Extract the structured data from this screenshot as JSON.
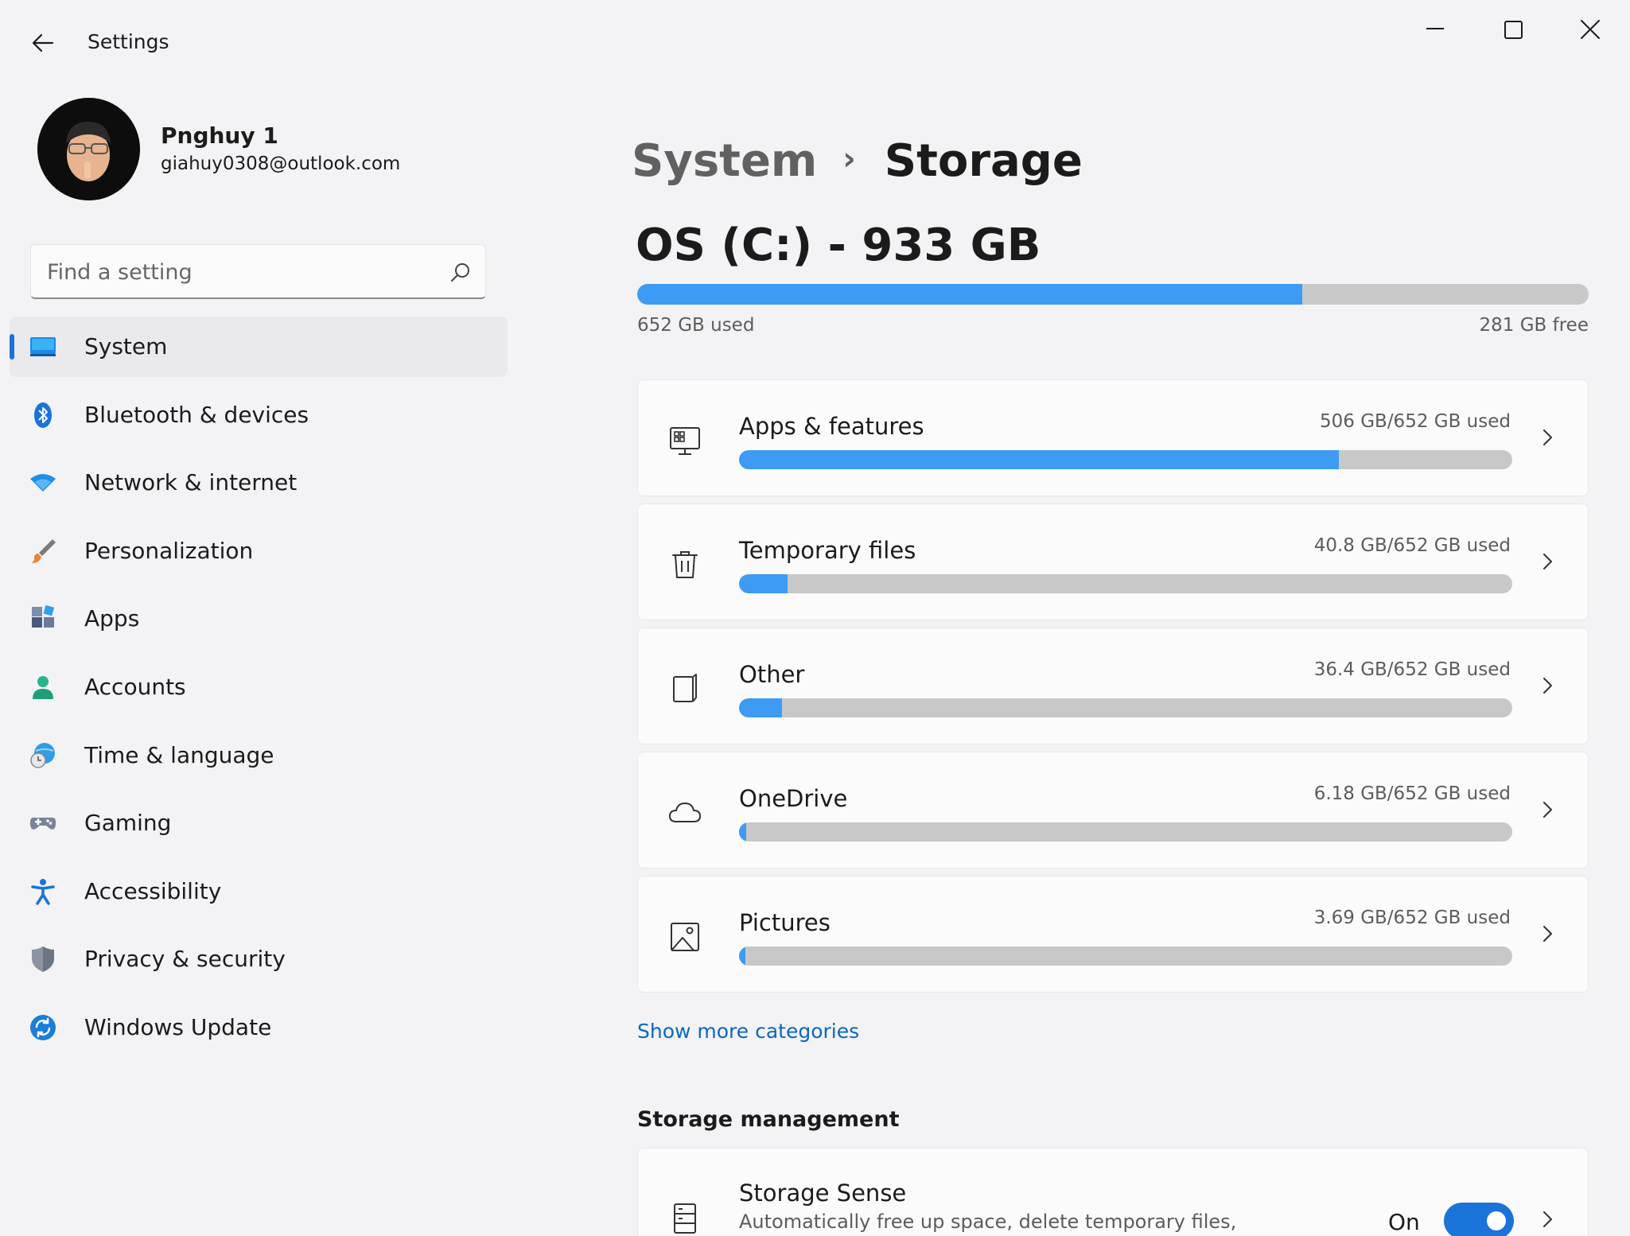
{
  "window": {
    "title": "Settings",
    "icons": [
      "back-arrow-icon",
      "minimize-icon",
      "maximize-icon",
      "close-icon"
    ]
  },
  "profile": {
    "name": "Pnghuy 1",
    "email": "giahuy0308@outlook.com"
  },
  "search": {
    "placeholder": "Find a setting",
    "value": ""
  },
  "nav": {
    "items": [
      {
        "label": "System",
        "icon": "system-display-icon",
        "active": true
      },
      {
        "label": "Bluetooth & devices",
        "icon": "bluetooth-icon",
        "active": false
      },
      {
        "label": "Network & internet",
        "icon": "wifi-icon",
        "active": false
      },
      {
        "label": "Personalization",
        "icon": "paintbrush-icon",
        "active": false
      },
      {
        "label": "Apps",
        "icon": "apps-icon",
        "active": false
      },
      {
        "label": "Accounts",
        "icon": "person-icon",
        "active": false
      },
      {
        "label": "Time & language",
        "icon": "globe-clock-icon",
        "active": false
      },
      {
        "label": "Gaming",
        "icon": "gamepad-icon",
        "active": false
      },
      {
        "label": "Accessibility",
        "icon": "accessibility-icon",
        "active": false
      },
      {
        "label": "Privacy & security",
        "icon": "shield-icon",
        "active": false
      },
      {
        "label": "Windows Update",
        "icon": "sync-icon",
        "active": false
      }
    ]
  },
  "breadcrumb": {
    "parent": "System",
    "separator": "›",
    "current": "Storage"
  },
  "drive": {
    "title": "OS (C:) - 933 GB",
    "used_label": "652 GB used",
    "free_label": "281 GB free",
    "used_fraction": 0.699
  },
  "categories": [
    {
      "label": "Apps & features",
      "used": "506 GB/652 GB used",
      "fraction": 0.776,
      "icon": "apps-features-icon"
    },
    {
      "label": "Temporary files",
      "used": "40.8 GB/652 GB used",
      "fraction": 0.063,
      "icon": "trash-icon"
    },
    {
      "label": "Other",
      "used": "36.4 GB/652 GB used",
      "fraction": 0.056,
      "icon": "other-files-icon"
    },
    {
      "label": "OneDrive",
      "used": "6.18 GB/652 GB used",
      "fraction": 0.0095,
      "icon": "cloud-icon"
    },
    {
      "label": "Pictures",
      "used": "3.69 GB/652 GB used",
      "fraction": 0.0057,
      "icon": "picture-icon"
    }
  ],
  "show_more": "Show more categories",
  "management": {
    "heading": "Storage management",
    "storage_sense": {
      "title": "Storage Sense",
      "description": "Automatically free up space, delete temporary files,",
      "state": "On",
      "enabled": true,
      "icon": "storage-drive-icon"
    }
  },
  "colors": {
    "accent": "#1a73d9",
    "bar_fill": "#3d9bf3",
    "bar_track": "#c8c8c8",
    "link": "#0b66c2",
    "background": "#f3f3f6",
    "card": "#fbfbfb"
  }
}
